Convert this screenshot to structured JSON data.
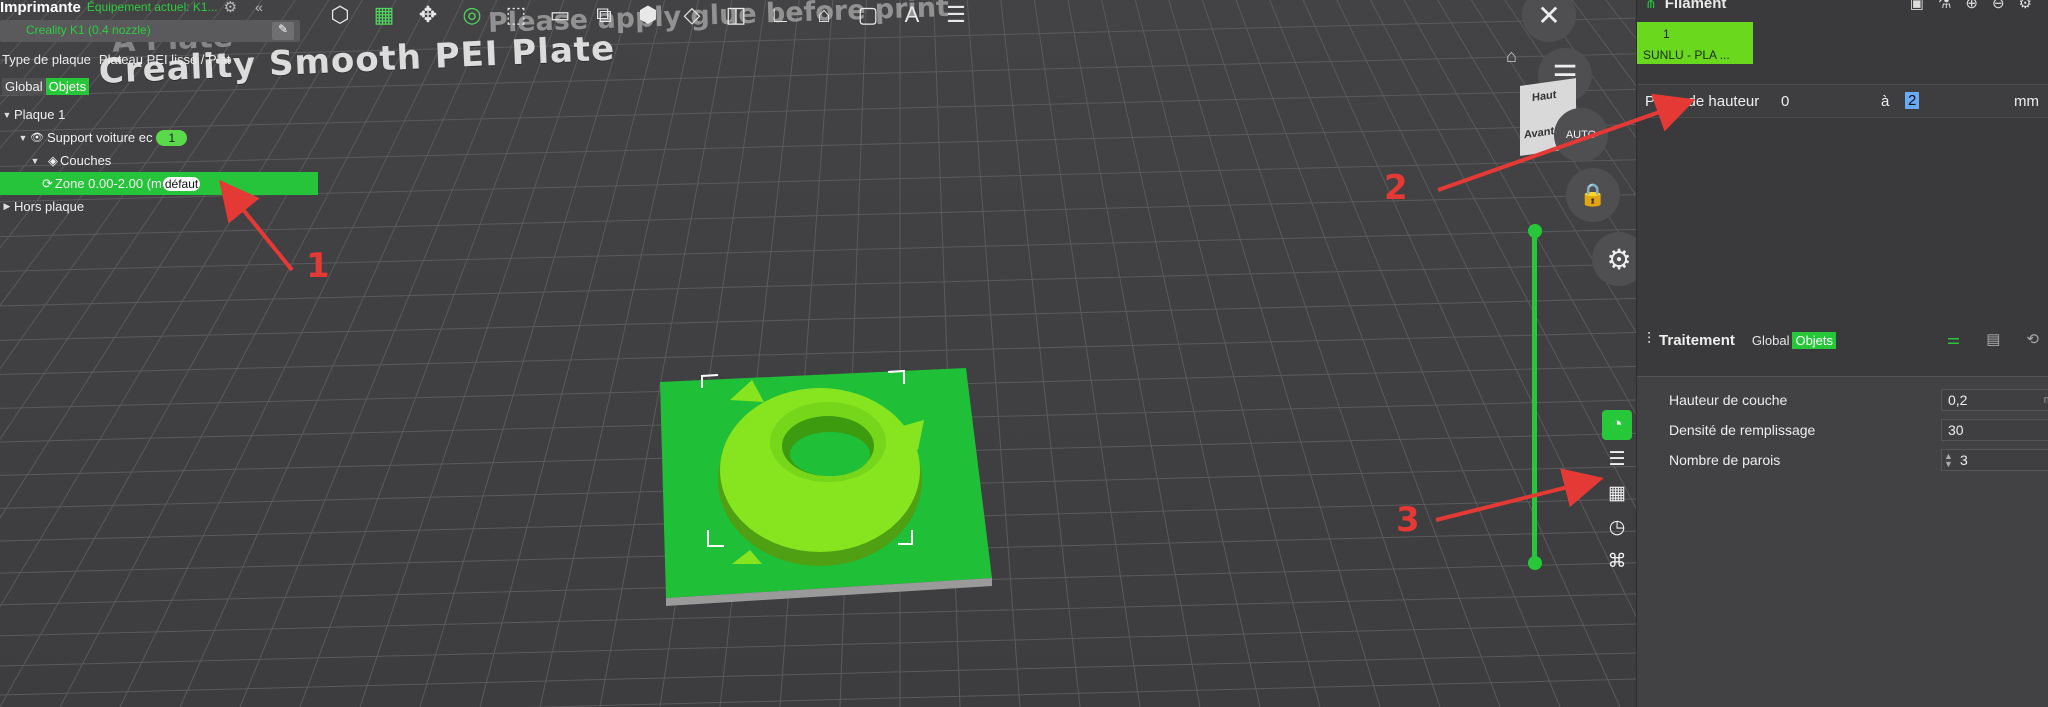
{
  "viewport": {
    "plate_title": "Creality Smooth PEI Plate",
    "ghost_plate": "A Plate",
    "ghost_message": "Please apply glue before print"
  },
  "top_toolbar": {
    "icons": [
      "add-object-icon",
      "grid-plate-icon",
      "arrange-icon",
      "orient-icon",
      "split-icon",
      "layout-icon",
      "split-parts-icon",
      "cube-icon",
      "cut-icon",
      "support-paint-icon",
      "measure-icon",
      "seam-icon",
      "assembly-icon",
      "text-icon",
      "layers-icon"
    ],
    "auto_label": "AUTO"
  },
  "left_panel": {
    "printer_label": "Imprimante",
    "printer_current": "Équipement actuel: K1...",
    "printer_name": "Creality K1 (0.4 nozzle)",
    "plate_type_label": "Type de plaque",
    "plate_type_value": "Plateau PEI lisse / Plat",
    "tabs": [
      "Global",
      "Objets"
    ],
    "tree": {
      "plate": "Plaque 1",
      "object": "Support voiture ec",
      "object_badge": "1",
      "layers": "Couches",
      "zone": "Zone 0.00-2.00 (m",
      "zone_tag": "défaut",
      "outside": "Hors plaque"
    }
  },
  "nav": {
    "cube_top": "Haut",
    "cube_front": "Avant",
    "auto": "AUTO"
  },
  "right_panel": {
    "filament_title": "Filament",
    "filament_slot": "1",
    "filament_name": "SUNLU - PLA ...",
    "height_range_label": "Plage de hauteur",
    "height_from": "0",
    "height_a": "à",
    "height_to": "2",
    "height_unit": "mm",
    "process_title": "Traitement",
    "process_tabs": [
      "Global",
      "Objets"
    ],
    "params": [
      {
        "label": "Hauteur de couche",
        "value": "0,2",
        "unit": "mm"
      },
      {
        "label": "Densité de remplissage",
        "value": "30",
        "unit": "%"
      },
      {
        "label": "Nombre de parois",
        "value": "3",
        "unit": ""
      }
    ]
  },
  "annotations": [
    "1",
    "2",
    "3"
  ],
  "colors": {
    "accent": "#27c73a",
    "arrow": "#e53935",
    "model": "#7ee21a",
    "bed": "#22b43a"
  }
}
